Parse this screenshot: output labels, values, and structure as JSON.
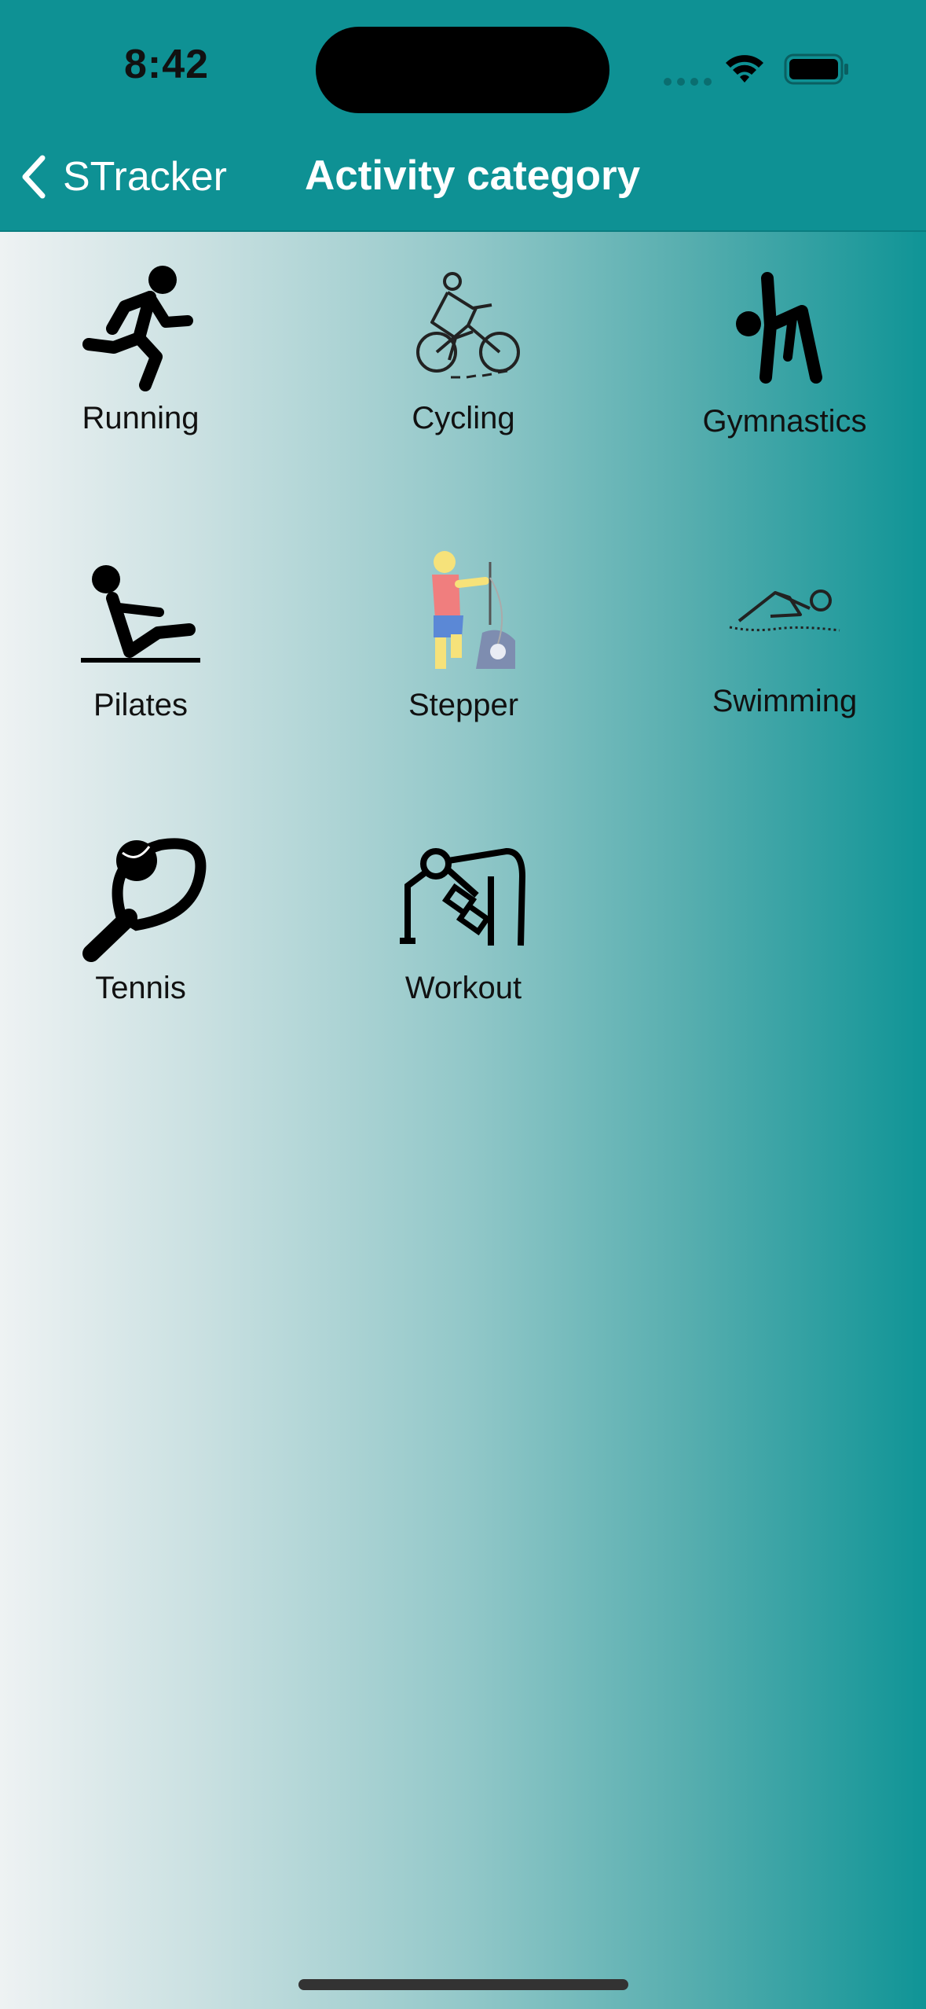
{
  "status_bar": {
    "time": "8:42",
    "icons": [
      "signal-dots-icon",
      "wifi-icon",
      "battery-icon"
    ]
  },
  "nav": {
    "back_label": "STracker",
    "title": "Activity category"
  },
  "colors": {
    "header_bg": "#0e9194",
    "gradient_start": "#eef2f3",
    "gradient_end": "#0f9496",
    "label_text": "#111111",
    "nav_text": "#ffffff"
  },
  "categories": [
    {
      "label": "Running",
      "icon": "running-icon"
    },
    {
      "label": "Cycling",
      "icon": "cycling-icon"
    },
    {
      "label": "Gymnastics",
      "icon": "gymnastics-icon"
    },
    {
      "label": "Pilates",
      "icon": "pilates-icon"
    },
    {
      "label": "Stepper",
      "icon": "stepper-icon"
    },
    {
      "label": "Swimming",
      "icon": "swimming-icon"
    },
    {
      "label": "Tennis",
      "icon": "tennis-icon"
    },
    {
      "label": "Workout",
      "icon": "workout-icon"
    }
  ]
}
